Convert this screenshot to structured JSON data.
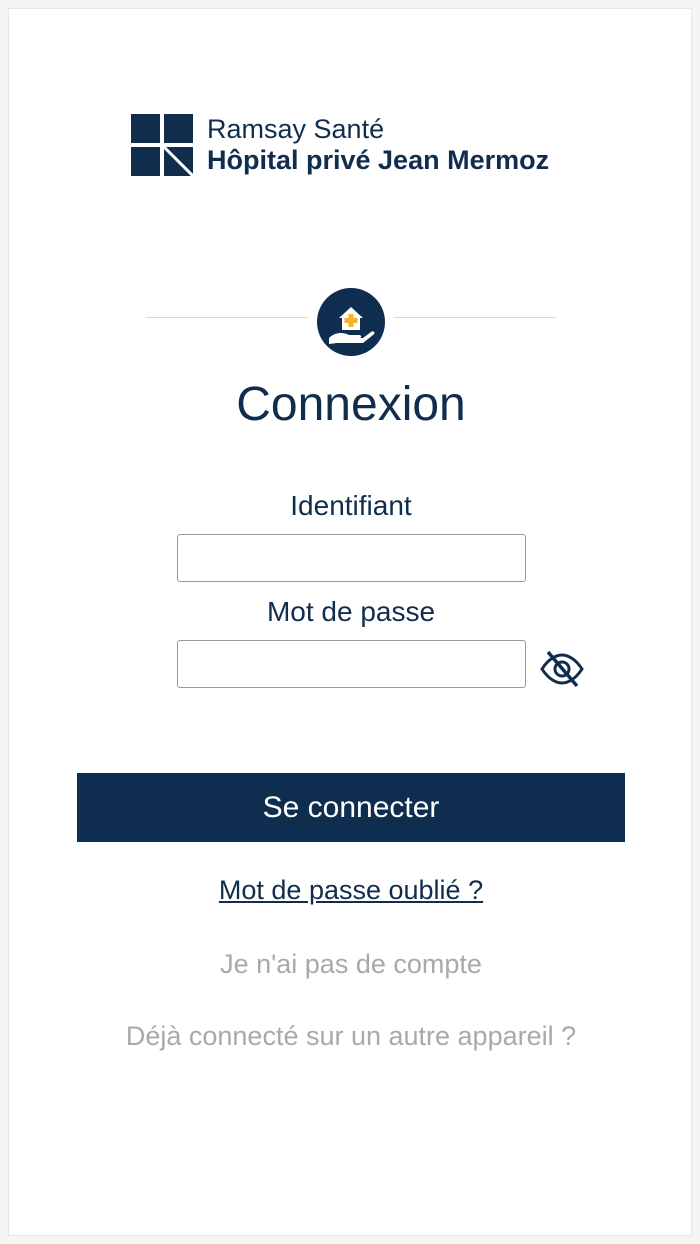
{
  "brand": {
    "line1": "Ramsay Santé",
    "line2": "Hôpital privé Jean Mermoz",
    "color": "#112d4e",
    "logo_icon": "ramsay-grid-logo"
  },
  "hero_icon": "hand-house-care-icon",
  "page": {
    "title": "Connexion"
  },
  "form": {
    "username_label": "Identifiant",
    "username_value": "",
    "password_label": "Mot de passe",
    "password_value": "",
    "toggle_icon": "eye-slash-icon"
  },
  "actions": {
    "login_label": "Se connecter",
    "forgot_password": "Mot de passe oublié ?",
    "no_account": "Je n'ai pas de compte",
    "other_device": "Déjà connecté sur un autre appareil ?"
  },
  "colors": {
    "primary": "#0f2d4e",
    "accent": "#f2b233",
    "muted": "#a9a9a9"
  }
}
